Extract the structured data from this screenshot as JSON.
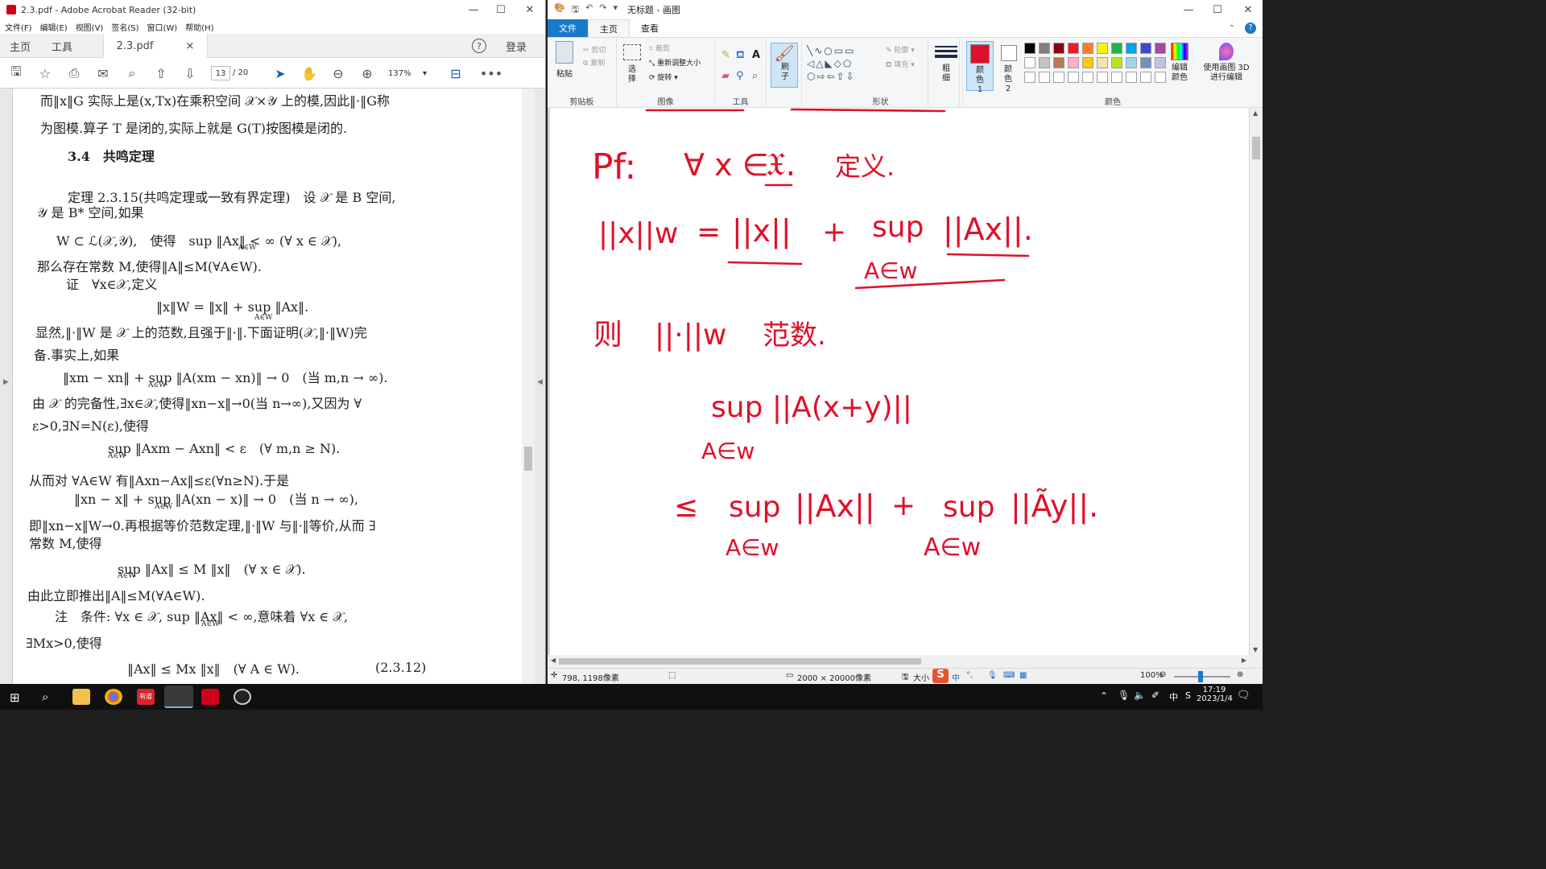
{
  "acrobat": {
    "title": "2.3.pdf - Adobe Acrobat Reader (32-bit)",
    "menu": [
      "文件(F)",
      "编辑(E)",
      "视图(V)",
      "签名(S)",
      "窗口(W)",
      "帮助(H)"
    ],
    "tabs": {
      "home": "主页",
      "tools": "工具",
      "doc": "2.3.pdf",
      "close": "×"
    },
    "help": "?",
    "login": "登录",
    "page_current": "13",
    "page_total": "/ 20",
    "zoom": "137%",
    "more": "•••",
    "doc_lines": [
      "而‖x‖G 实际上是(x,Tx)在乘积空间 𝒳×𝒴 上的模,因此‖·‖G称",
      "为图模.算子 T 是闭的,实际上就是 G(T)按图模是闭的.",
      "3.4　共鸣定理",
      "定理 2.3.15(共鸣定理或一致有界定理)　设 𝒳 是 B 空间,",
      "𝒴 是 B* 空间,如果",
      "W ⊂ ℒ(𝒳,𝒴),　使得　sup ‖Ax‖ < ∞ (∀ x ∈ 𝒳),",
      "A∈W",
      "那么存在常数 M,使得‖A‖≤M(∀A∈W).",
      "证　∀x∈𝒳,定义",
      "‖x‖W = ‖x‖ + sup ‖Ax‖.",
      "A∈W",
      "显然,‖·‖W 是 𝒳 上的范数,且强于‖·‖.下面证明(𝒳,‖·‖W)完",
      "备.事实上,如果",
      "‖xm − xn‖ + sup ‖A(xm − xn)‖ → 0　(当 m,n → ∞).",
      "A∈W",
      "由 𝒳 的完备性,∃x∈𝒳,使得‖xn−x‖→0(当 n→∞),又因为 ∀",
      "ε>0,∃N=N(ε),使得",
      "sup ‖Axm − Axn‖ < ε　(∀ m,n ≥ N).",
      "A∈W",
      "从而对 ∀A∈W 有‖Axn−Ax‖≤ε(∀n≥N).于是",
      "‖xn − x‖ + sup ‖A(xn − x)‖ → 0　(当 n → ∞),",
      "A∈W",
      "即‖xn−x‖W→0.再根据等价范数定理,‖·‖W 与‖·‖等价,从而 ∃",
      "常数 M,使得",
      "sup ‖Ax‖ ≤ M ‖x‖　(∀ x ∈ 𝒳).",
      "A∈W",
      "由此立即推出‖A‖≤M(∀A∈W).",
      "注　条件: ∀x ∈ 𝒳, sup ‖Ax‖ < ∞,意味着 ∀x ∈ 𝒳,",
      "A∈W",
      "∃Mx>0,使得",
      "‖Ax‖ ≤ Mx ‖x‖　(∀ A ∈ W).",
      "(2.3.12)"
    ]
  },
  "paint": {
    "title": "无标题 - 画图",
    "ribbon_tabs": [
      "文件",
      "主页",
      "查看"
    ],
    "groups": {
      "clipboard": {
        "label": "剪贴板",
        "paste": "粘贴",
        "cut": "剪切",
        "copy": "复制"
      },
      "image": {
        "label": "图像",
        "select": "选择",
        "crop": "裁剪",
        "resize": "重新调整大小",
        "rotate": "旋转"
      },
      "tools": {
        "label": "工具"
      },
      "brush": {
        "label": "刷子"
      },
      "shapes": {
        "label": "形状",
        "outline": "轮廓",
        "fill": "填充"
      },
      "size": {
        "label": "粗细"
      },
      "colors": {
        "label": "颜色",
        "color1": "颜色 1",
        "color2": "颜色 2",
        "edit": "编辑颜色",
        "paint3d": "使用画图 3D 进行编辑"
      }
    },
    "color1_hex": "#e0102a",
    "color2_hex": "#ffffff",
    "palette": [
      "#000000",
      "#7f7f7f",
      "#880015",
      "#ed1c24",
      "#ff7f27",
      "#fff200",
      "#22b14c",
      "#00a2e8",
      "#3f48cc",
      "#a349a4",
      "#ffffff",
      "#c3c3c3",
      "#b97a57",
      "#ffaec9",
      "#ffc90e",
      "#efe4b0",
      "#b5e61d",
      "#99d9ea",
      "#7092be",
      "#c8bfe7"
    ],
    "handwriting": {
      "pf": "Pf:",
      "forall": "∀ x ∈",
      "spaceX": "𝔛.",
      "define": "定义.",
      "normW": "||x||w",
      "eq": "=",
      "normx": "||x||",
      "plus": "+",
      "sup": "sup",
      "normAx": "||Ax||.",
      "AinW": "A∈w",
      "then": "则",
      "normDot": "||·||w",
      "isnorm": "范数.",
      "supAxy": "sup ||A(x+y)||",
      "le": "≤",
      "normAx2": "||Ax||",
      "normAy": "||Ãy||."
    },
    "status": {
      "cursor": "798, 1198像素",
      "canvas_size": "2000 × 20000像素",
      "size_label": "大小",
      "ime": "中",
      "zoom": "100%"
    }
  },
  "taskbar": {
    "time": "17:19",
    "date": "2023/1/4",
    "ime": "中"
  }
}
